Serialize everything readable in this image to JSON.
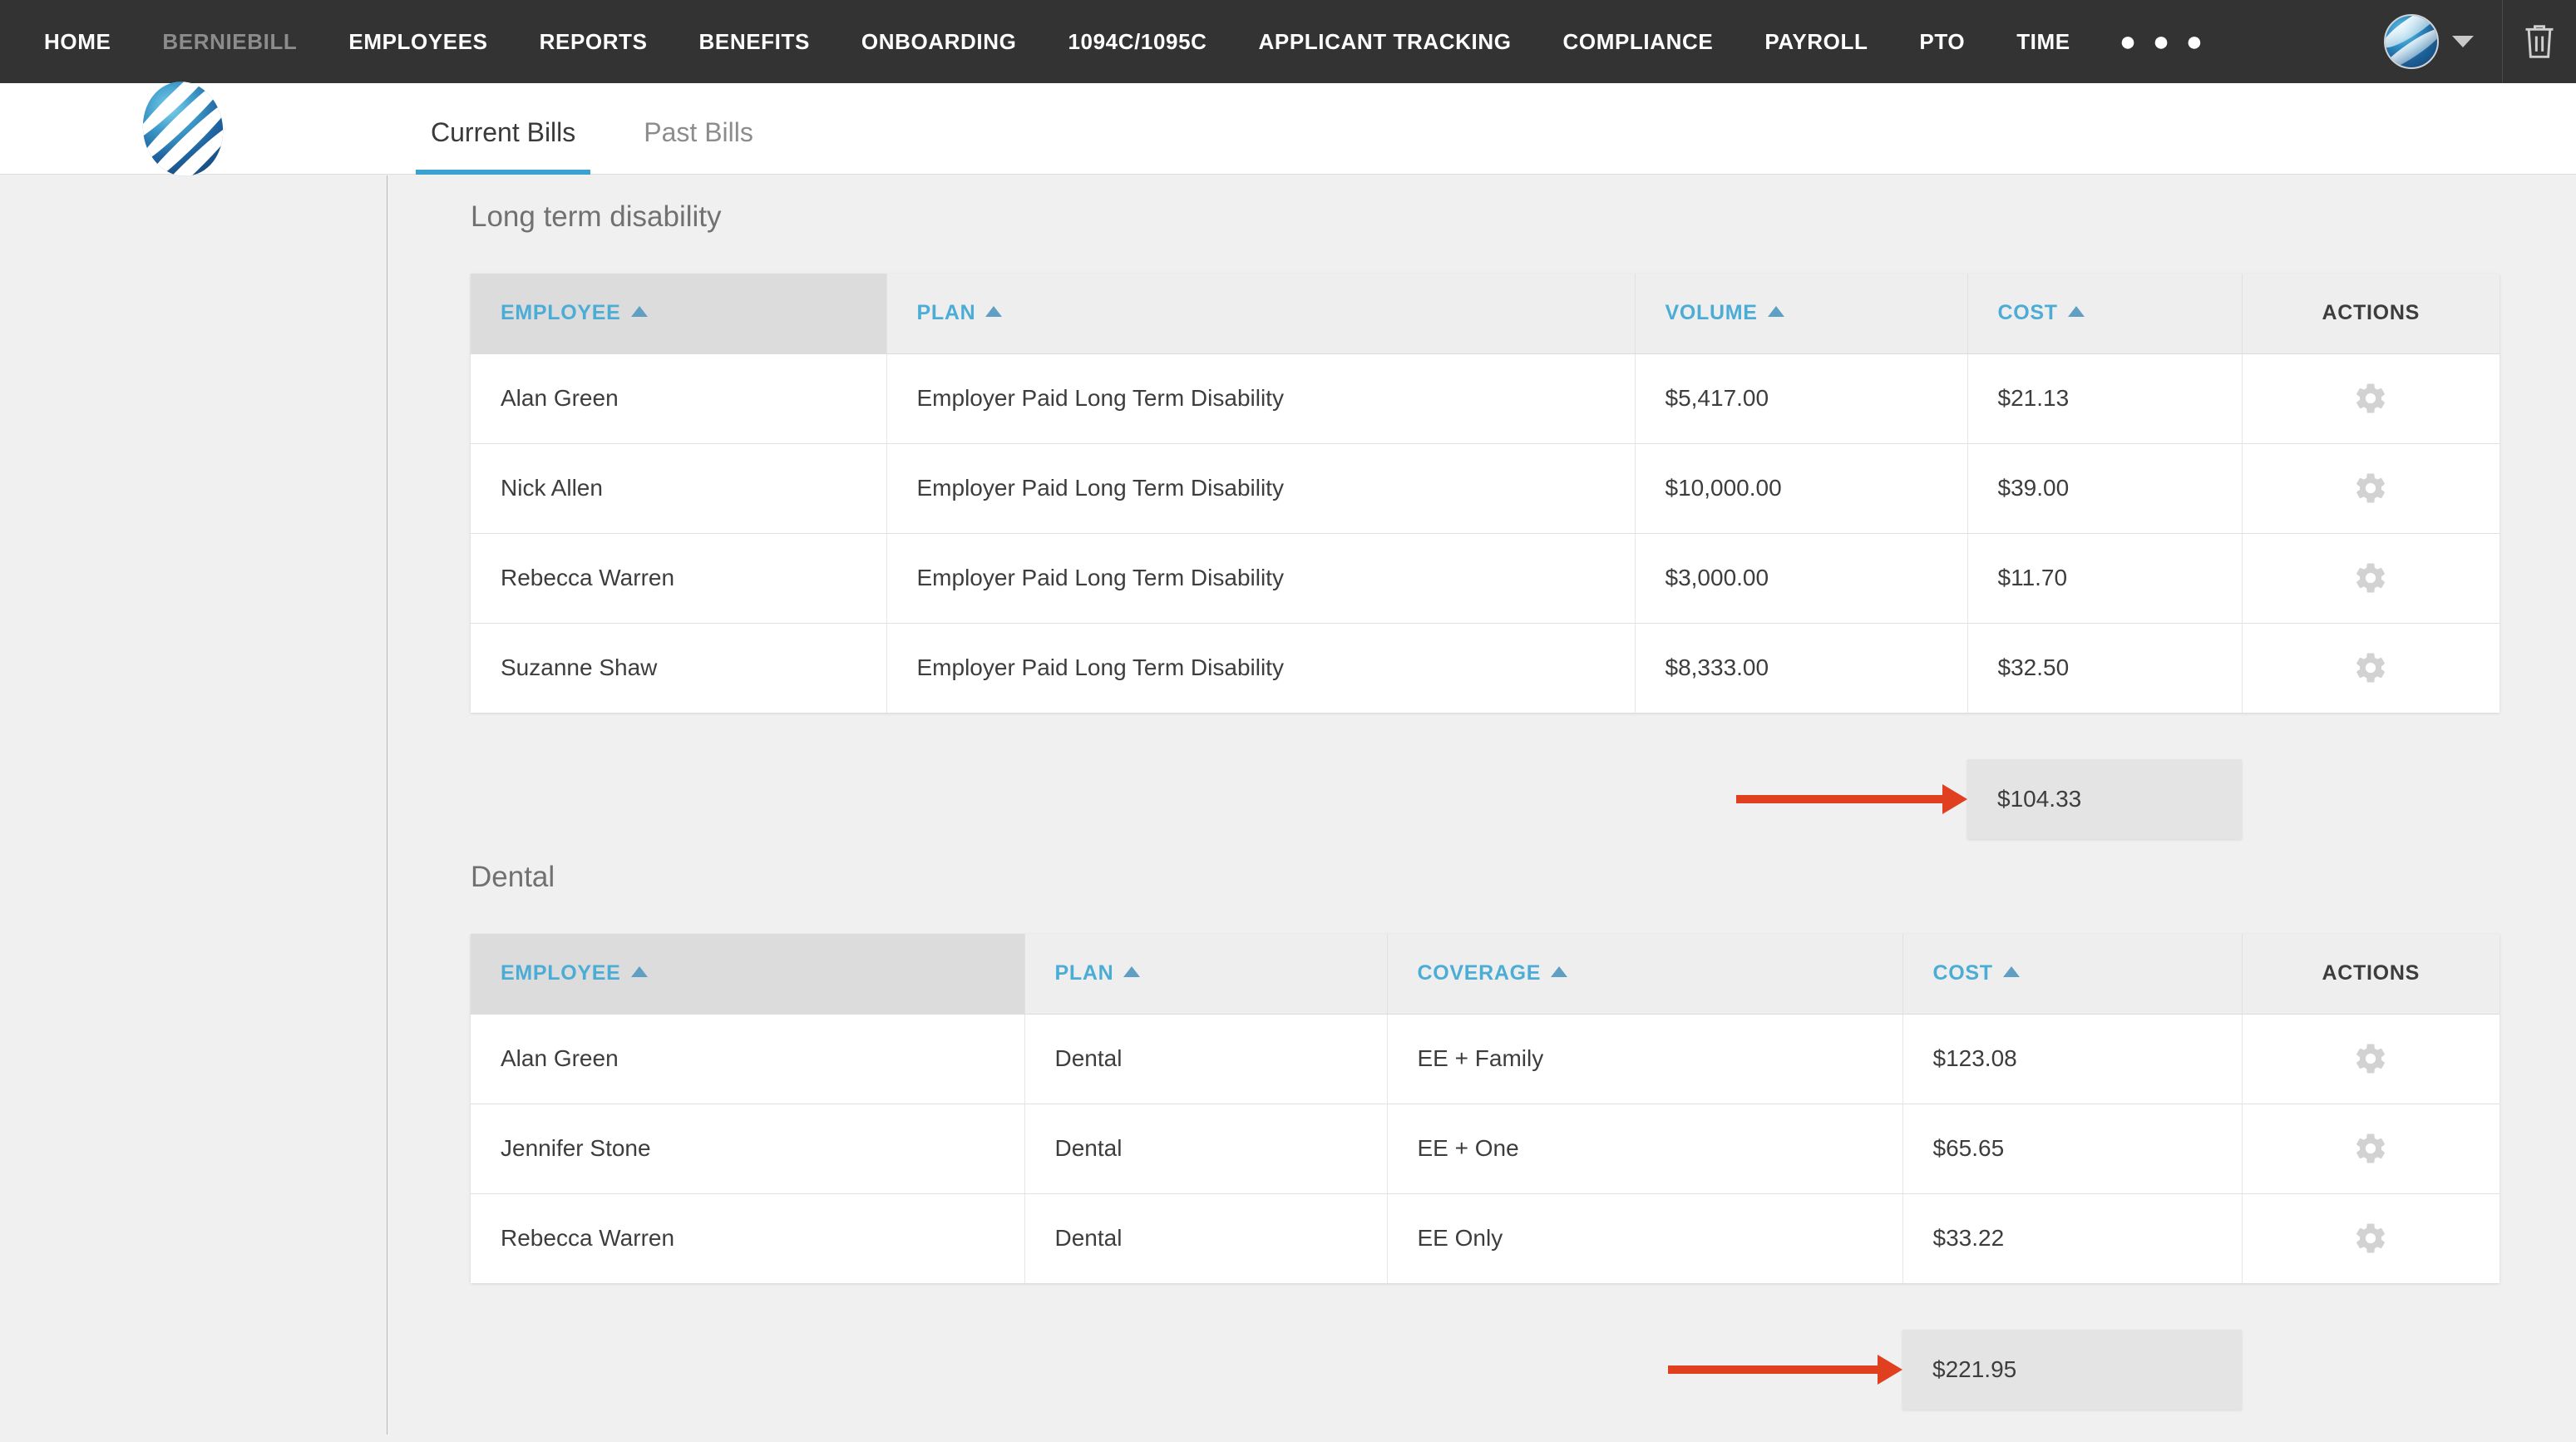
{
  "nav": {
    "items": [
      {
        "label": "HOME",
        "muted": false
      },
      {
        "label": "BERNIEBILL",
        "muted": true
      },
      {
        "label": "EMPLOYEES",
        "muted": false
      },
      {
        "label": "REPORTS",
        "muted": false
      },
      {
        "label": "BENEFITS",
        "muted": false
      },
      {
        "label": "ONBOARDING",
        "muted": false
      },
      {
        "label": "1094C/1095C",
        "muted": false
      },
      {
        "label": "APPLICANT TRACKING",
        "muted": false
      },
      {
        "label": "COMPLIANCE",
        "muted": false
      },
      {
        "label": "PAYROLL",
        "muted": false
      },
      {
        "label": "PTO",
        "muted": false
      },
      {
        "label": "TIME",
        "muted": false
      }
    ],
    "more_label": "● ● ●",
    "avatar_icon": "user-avatar-globe-icon",
    "caret_icon": "chevron-down-icon",
    "trash_icon": "trash-icon",
    "bar_color": "#333333"
  },
  "subheader": {
    "logo_icon": "company-logo-globe-icon",
    "accent_color": "#3ba1d0",
    "tabs": [
      {
        "label": "Current Bills",
        "active": true
      },
      {
        "label": "Past Bills",
        "active": false
      }
    ]
  },
  "sections": [
    {
      "title": "Long term disability",
      "columns": [
        {
          "label": "EMPLOYEE",
          "sortable": true,
          "sorted": true
        },
        {
          "label": "PLAN",
          "sortable": true,
          "sorted": false
        },
        {
          "label": "VOLUME",
          "sortable": true,
          "sorted": false
        },
        {
          "label": "COST",
          "sortable": true,
          "sorted": false
        },
        {
          "label": "ACTIONS",
          "sortable": false,
          "sorted": false
        }
      ],
      "rows": [
        {
          "employee": "Alan Green",
          "plan": "Employer Paid Long Term Disability",
          "volume": "$5,417.00",
          "cost": "$21.13",
          "action_icon": "gear-icon"
        },
        {
          "employee": "Nick Allen",
          "plan": "Employer Paid Long Term Disability",
          "volume": "$10,000.00",
          "cost": "$39.00",
          "action_icon": "gear-icon"
        },
        {
          "employee": "Rebecca Warren",
          "plan": "Employer Paid Long Term Disability",
          "volume": "$3,000.00",
          "cost": "$11.70",
          "action_icon": "gear-icon"
        },
        {
          "employee": "Suzanne Shaw",
          "plan": "Employer Paid Long Term Disability",
          "volume": "$8,333.00",
          "cost": "$32.50",
          "action_icon": "gear-icon"
        }
      ],
      "total": "$104.33",
      "annotation_color": "#e0401f"
    },
    {
      "title": "Dental",
      "columns": [
        {
          "label": "EMPLOYEE",
          "sortable": true,
          "sorted": true
        },
        {
          "label": "PLAN",
          "sortable": true,
          "sorted": false
        },
        {
          "label": "COVERAGE",
          "sortable": true,
          "sorted": false
        },
        {
          "label": "COST",
          "sortable": true,
          "sorted": false
        },
        {
          "label": "ACTIONS",
          "sortable": false,
          "sorted": false
        }
      ],
      "rows": [
        {
          "employee": "Alan Green",
          "plan": "Dental",
          "coverage": "EE + Family",
          "cost": "$123.08",
          "action_icon": "gear-icon"
        },
        {
          "employee": "Jennifer Stone",
          "plan": "Dental",
          "coverage": "EE + One",
          "cost": "$65.65",
          "action_icon": "gear-icon"
        },
        {
          "employee": "Rebecca Warren",
          "plan": "Dental",
          "coverage": "EE Only",
          "cost": "$33.22",
          "action_icon": "gear-icon"
        }
      ],
      "total": "$221.95",
      "annotation_color": "#e0401f"
    }
  ]
}
